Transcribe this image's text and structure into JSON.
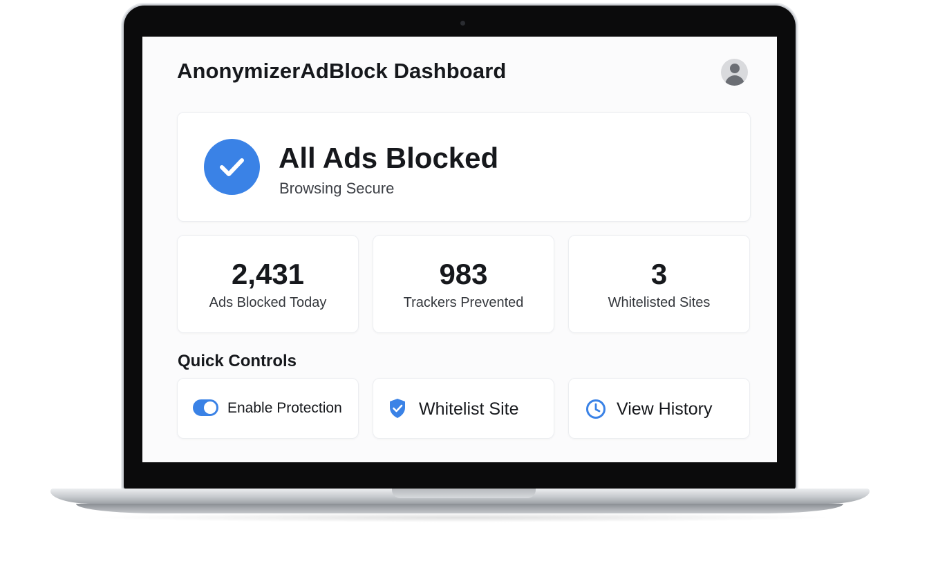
{
  "app": {
    "title": "AnonymizerAdBlock Dashboard"
  },
  "status": {
    "title": "All Ads Blocked",
    "subtitle": "Browsing Secure",
    "state": "protected"
  },
  "stats": [
    {
      "value": "2,431",
      "label": "Ads Blocked Today"
    },
    {
      "value": "983",
      "label": "Trackers Prevented"
    },
    {
      "value": "3",
      "label": "Whitelisted Sites"
    }
  ],
  "quick_controls": {
    "title": "Quick Controls",
    "items": [
      {
        "label": "Enable Protection",
        "icon": "toggle-switch",
        "state": "on"
      },
      {
        "label": "Whitelist Site",
        "icon": "shield-check-icon"
      },
      {
        "label": "View History",
        "icon": "clock-icon"
      }
    ]
  },
  "colors": {
    "accent": "#3a82e6",
    "text": "#16181c",
    "background": "#fbfbfc"
  }
}
